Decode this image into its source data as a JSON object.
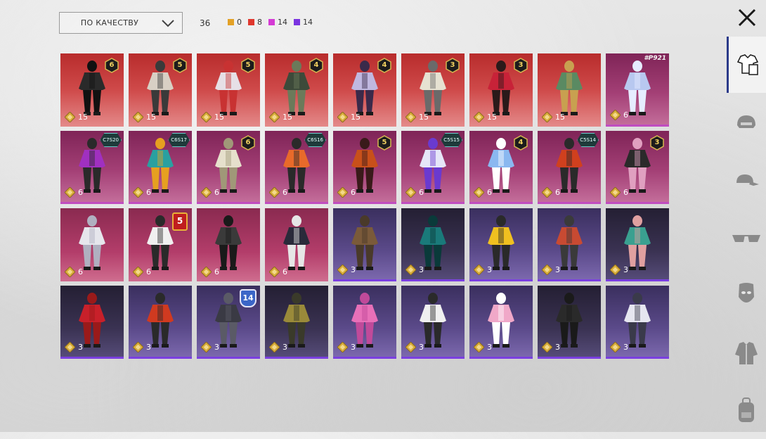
{
  "sort": {
    "label": "ПО КАЧЕСТВУ"
  },
  "summary": {
    "total": "36",
    "counts": [
      {
        "value": "0",
        "color": "#e3a126"
      },
      {
        "value": "8",
        "color": "#e0382e"
      },
      {
        "value": "14",
        "color": "#d43bd4"
      },
      {
        "value": "14",
        "color": "#7a34e0"
      }
    ]
  },
  "tabs": [
    {
      "icon": "outfit-icon",
      "active": true
    },
    {
      "icon": "helmet-icon",
      "active": false
    },
    {
      "icon": "cap-icon",
      "active": false
    },
    {
      "icon": "glasses-icon",
      "active": false
    },
    {
      "icon": "mask-icon",
      "active": false
    },
    {
      "icon": "jacket-icon",
      "active": false
    },
    {
      "icon": "backpack-icon",
      "active": false
    }
  ],
  "items": [
    {
      "rarity": "red",
      "cost": "15",
      "badge": {
        "type": "level",
        "text": "6"
      },
      "body": "#2a2a2a",
      "accent": "#111111"
    },
    {
      "rarity": "red",
      "cost": "15",
      "badge": {
        "type": "level",
        "text": "5"
      },
      "body": "#d8d0c4",
      "accent": "#3a3a3a"
    },
    {
      "rarity": "red",
      "cost": "15",
      "badge": {
        "type": "level",
        "text": "5"
      },
      "body": "#e6e0e6",
      "accent": "#c83232"
    },
    {
      "rarity": "red",
      "cost": "15",
      "badge": {
        "type": "level",
        "text": "4"
      },
      "body": "#3d4a3a",
      "accent": "#6b7a5a"
    },
    {
      "rarity": "red",
      "cost": "15",
      "badge": {
        "type": "level",
        "text": "4"
      },
      "body": "#c0b8e0",
      "accent": "#3a2a4a"
    },
    {
      "rarity": "red",
      "cost": "15",
      "badge": {
        "type": "level",
        "text": "3"
      },
      "body": "#e6e2d2",
      "accent": "#6a6a6a"
    },
    {
      "rarity": "red",
      "cost": "15",
      "badge": {
        "type": "level",
        "text": "3"
      },
      "body": "#c82238",
      "accent": "#2a1a1a"
    },
    {
      "rarity": "red",
      "cost": "15",
      "badge": null,
      "body": "#5a8a62",
      "accent": "#c8a050"
    },
    {
      "rarity": "pink",
      "cost": "6",
      "badge": {
        "type": "note",
        "text": "#P921"
      },
      "body": "#b8c8f0",
      "accent": "#e6ecff"
    },
    {
      "rarity": "pink",
      "cost": "6",
      "badge": {
        "type": "code",
        "text": "C7S20"
      },
      "body": "#a030c0",
      "accent": "#2a2a2a"
    },
    {
      "rarity": "pink",
      "cost": "6",
      "badge": {
        "type": "code",
        "text": "C6S17"
      },
      "body": "#2aa0a0",
      "accent": "#e6a020"
    },
    {
      "rarity": "pink",
      "cost": "6",
      "badge": {
        "type": "level",
        "text": "6"
      },
      "body": "#e6e0cc",
      "accent": "#a09878"
    },
    {
      "rarity": "pink",
      "cost": "6",
      "badge": {
        "type": "code",
        "text": "C6S16"
      },
      "body": "#e86a2a",
      "accent": "#2a2a2a"
    },
    {
      "rarity": "pink",
      "cost": "6",
      "badge": {
        "type": "level",
        "text": "5"
      },
      "body": "#c8501a",
      "accent": "#3a1a1a"
    },
    {
      "rarity": "pink",
      "cost": "6",
      "badge": {
        "type": "code",
        "text": "C5S15"
      },
      "body": "#e6e6f8",
      "accent": "#6a3ad0"
    },
    {
      "rarity": "pink",
      "cost": "6",
      "badge": {
        "type": "level",
        "text": "4"
      },
      "body": "#8ab8f0",
      "accent": "#ffffff"
    },
    {
      "rarity": "pink",
      "cost": "6",
      "badge": {
        "type": "code",
        "text": "C5S14"
      },
      "body": "#d0401e",
      "accent": "#2a2a2a"
    },
    {
      "rarity": "pink",
      "cost": "6",
      "badge": {
        "type": "level",
        "text": "3"
      },
      "body": "#2a2a2a",
      "accent": "#e0a0c0"
    },
    {
      "rarity": "pinkred",
      "cost": "6",
      "badge": null,
      "body": "#e6e6ec",
      "accent": "#b0b0c0"
    },
    {
      "rarity": "pinkred",
      "cost": "6",
      "badge": {
        "type": "star",
        "text": "5"
      },
      "body": "#f0f0f0",
      "accent": "#2a2a2a"
    },
    {
      "rarity": "pinkred",
      "cost": "6",
      "badge": null,
      "body": "#3a3a3a",
      "accent": "#1a1a1a"
    },
    {
      "rarity": "pinkred",
      "cost": "6",
      "badge": null,
      "body": "#2a2a3a",
      "accent": "#e6e6e6"
    },
    {
      "rarity": "purple",
      "cost": "3",
      "badge": null,
      "body": "#7a5a3a",
      "accent": "#4a3a2a"
    },
    {
      "rarity": "dark",
      "cost": "3",
      "badge": null,
      "body": "#1a7a7a",
      "accent": "#0a3a3a"
    },
    {
      "rarity": "purple",
      "cost": "3",
      "badge": null,
      "body": "#f0c020",
      "accent": "#2a2a2a"
    },
    {
      "rarity": "purple",
      "cost": "3",
      "badge": null,
      "body": "#c84a32",
      "accent": "#3a3a3a"
    },
    {
      "rarity": "dark",
      "cost": "3",
      "badge": null,
      "body": "#3aa090",
      "accent": "#e0a0a0"
    },
    {
      "rarity": "dark",
      "cost": "3",
      "badge": null,
      "body": "#c8202a",
      "accent": "#9a1a1a"
    },
    {
      "rarity": "purple",
      "cost": "3",
      "badge": null,
      "body": "#d03a20",
      "accent": "#2a2a2a"
    },
    {
      "rarity": "purple",
      "cost": "3",
      "badge": {
        "type": "shield",
        "text": "14"
      },
      "body": "#3a3a44",
      "accent": "#5a5a66"
    },
    {
      "rarity": "dark",
      "cost": "3",
      "badge": null,
      "body": "#9a8a3a",
      "accent": "#3a3a2a"
    },
    {
      "rarity": "purple",
      "cost": "3",
      "badge": null,
      "body": "#e870b8",
      "accent": "#c04a9a"
    },
    {
      "rarity": "purple",
      "cost": "3",
      "badge": null,
      "body": "#f0f0f0",
      "accent": "#2a2a2a"
    },
    {
      "rarity": "purple",
      "cost": "3",
      "badge": null,
      "body": "#f0a8c8",
      "accent": "#ffffff"
    },
    {
      "rarity": "dark",
      "cost": "3",
      "badge": null,
      "body": "#2a2a2a",
      "accent": "#1a1a1a"
    },
    {
      "rarity": "purple",
      "cost": "3",
      "badge": null,
      "body": "#e6e6f0",
      "accent": "#3a3a4a"
    }
  ]
}
